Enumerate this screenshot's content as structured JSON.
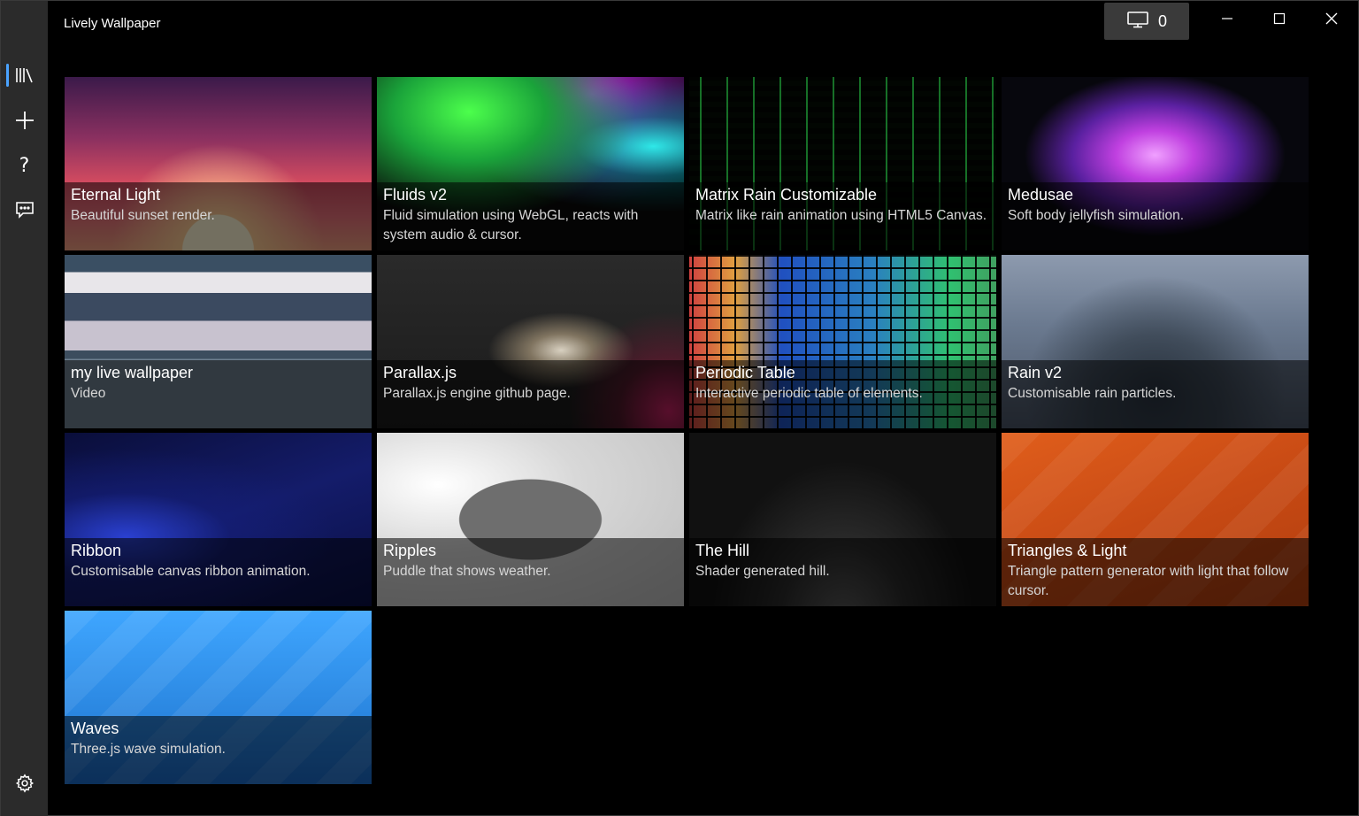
{
  "window": {
    "title": "Lively Wallpaper"
  },
  "titlebar": {
    "screen_count": "0"
  },
  "nav": {
    "items": [
      {
        "name": "library",
        "icon": "library-icon"
      },
      {
        "name": "add",
        "icon": "add-icon"
      },
      {
        "name": "help",
        "icon": "help-icon"
      },
      {
        "name": "feedback",
        "icon": "feedback-icon"
      }
    ],
    "settings_icon": "gear-icon"
  },
  "library": {
    "tiles": [
      {
        "title": "Eternal Light",
        "desc": "Beautiful sunset render."
      },
      {
        "title": "Fluids v2",
        "desc": "Fluid simulation using WebGL, reacts with system audio & cursor."
      },
      {
        "title": "Matrix Rain Customizable",
        "desc": "Matrix like rain animation using HTML5 Canvas."
      },
      {
        "title": "Medusae",
        "desc": "Soft body jellyfish simulation."
      },
      {
        "title": "my live wallpaper",
        "desc": "Video"
      },
      {
        "title": "Parallax.js",
        "desc": "Parallax.js engine github page."
      },
      {
        "title": "Periodic Table",
        "desc": "Interactive periodic table of elements."
      },
      {
        "title": "Rain v2",
        "desc": "Customisable rain particles."
      },
      {
        "title": "Ribbon",
        "desc": "Customisable canvas ribbon animation."
      },
      {
        "title": "Ripples",
        "desc": "Puddle that shows weather."
      },
      {
        "title": "The Hill",
        "desc": "Shader generated hill."
      },
      {
        "title": "Triangles & Light",
        "desc": "Triangle pattern generator with light that follow cursor."
      },
      {
        "title": "Waves",
        "desc": "Three.js wave simulation."
      }
    ]
  },
  "colors": {
    "accent": "#4aa3ff",
    "nav_bg": "#2b2b2b",
    "content_bg": "#000000"
  }
}
